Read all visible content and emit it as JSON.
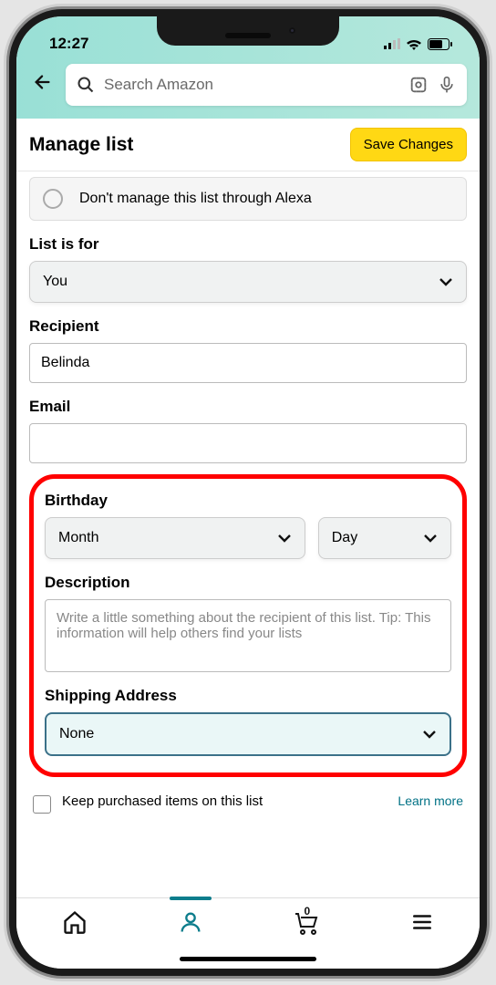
{
  "status": {
    "time": "12:27"
  },
  "search": {
    "placeholder": "Search Amazon"
  },
  "page": {
    "title": "Manage list",
    "save_label": "Save Changes"
  },
  "alexa": {
    "label": "Don't manage this list through Alexa"
  },
  "fields": {
    "list_for_label": "List is for",
    "list_for_value": "You",
    "recipient_label": "Recipient",
    "recipient_value": "Belinda",
    "email_label": "Email",
    "email_value": "",
    "birthday_label": "Birthday",
    "month_value": "Month",
    "day_value": "Day",
    "description_label": "Description",
    "description_placeholder": "Write a little something about the recipient of this list. Tip: This information will help others find your lists",
    "shipping_label": "Shipping Address",
    "shipping_value": "None"
  },
  "keep": {
    "label": "Keep purchased items on this list",
    "learn_more": "Learn more"
  },
  "cart": {
    "count": "0"
  }
}
